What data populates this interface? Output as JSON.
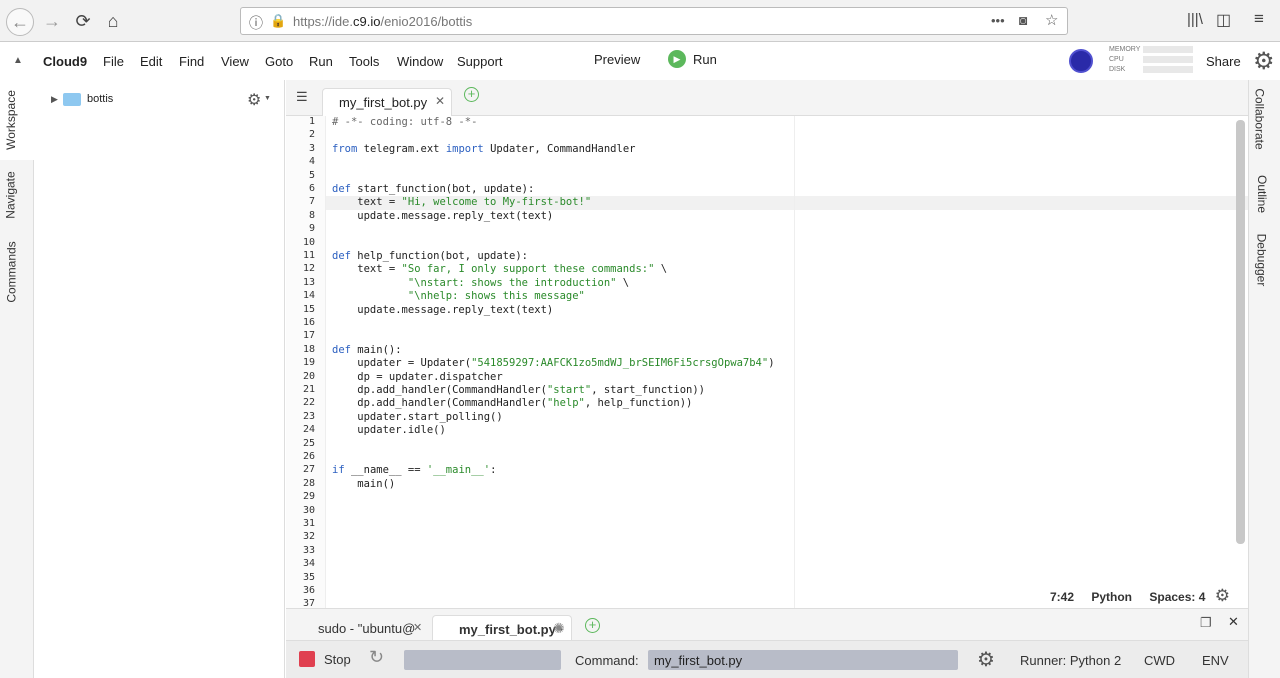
{
  "browser": {
    "url_prefix": "https://ide.",
    "url_host": "c9.io",
    "url_path": "/enio2016/bottis",
    "more_label": "•••"
  },
  "menu": {
    "brand": "Cloud9",
    "items": [
      "File",
      "Edit",
      "Find",
      "View",
      "Goto",
      "Run",
      "Tools",
      "Window",
      "Support"
    ],
    "preview": "Preview",
    "run": "Run",
    "share": "Share",
    "meters": [
      "MEMORY",
      "CPU",
      "DISK"
    ]
  },
  "left_tabs": [
    "Workspace",
    "Navigate",
    "Commands"
  ],
  "right_tabs": [
    "Collaborate",
    "Outline",
    "Debugger"
  ],
  "tree": {
    "root": "bottis"
  },
  "editor": {
    "tab_label": "my_first_bot.py",
    "line_numbers": [
      "1",
      "2",
      "3",
      "4",
      "5",
      "6",
      "7",
      "8",
      "9",
      "10",
      "11",
      "12",
      "13",
      "14",
      "15",
      "16",
      "17",
      "18",
      "19",
      "20",
      "21",
      "22",
      "23",
      "24",
      "25",
      "26",
      "27",
      "28",
      "29",
      "30",
      "31",
      "32",
      "33",
      "34",
      "35",
      "36",
      "37"
    ],
    "lines": [
      "# -*- coding: utf-8 -*-",
      "",
      "from telegram.ext import Updater, CommandHandler",
      "",
      "",
      "def start_function(bot, update):",
      "    text = \"Hi, welcome to My-first-bot!\"",
      "    update.message.reply_text(text)",
      "",
      "",
      "def help_function(bot, update):",
      "    text = \"So far, I only support these commands:\" \\",
      "            \"\\nstart: shows the introduction\" \\",
      "            \"\\nhelp: shows this message\"",
      "    update.message.reply_text(text)",
      "",
      "",
      "def main():",
      "    updater = Updater(\"541859297:AAFCK1zo5mdWJ_brSEIM6Fi5crsgOpwa7b4\")",
      "    dp = updater.dispatcher",
      "    dp.add_handler(CommandHandler(\"start\", start_function))",
      "    dp.add_handler(CommandHandler(\"help\", help_function))",
      "    updater.start_polling()",
      "    updater.idle()",
      "",
      "",
      "if __name__ == '__main__':",
      "    main()"
    ],
    "status_pos": "7:42",
    "status_lang": "Python",
    "status_spaces": "Spaces: 4"
  },
  "terminal": {
    "tab1": "sudo - \"ubuntu@",
    "tab2": "my_first_bot.py ·",
    "stop": "Stop",
    "command_label": "Command:",
    "command_value": "my_first_bot.py",
    "runner": "Runner: Python 2",
    "cwd": "CWD",
    "env": "ENV"
  }
}
